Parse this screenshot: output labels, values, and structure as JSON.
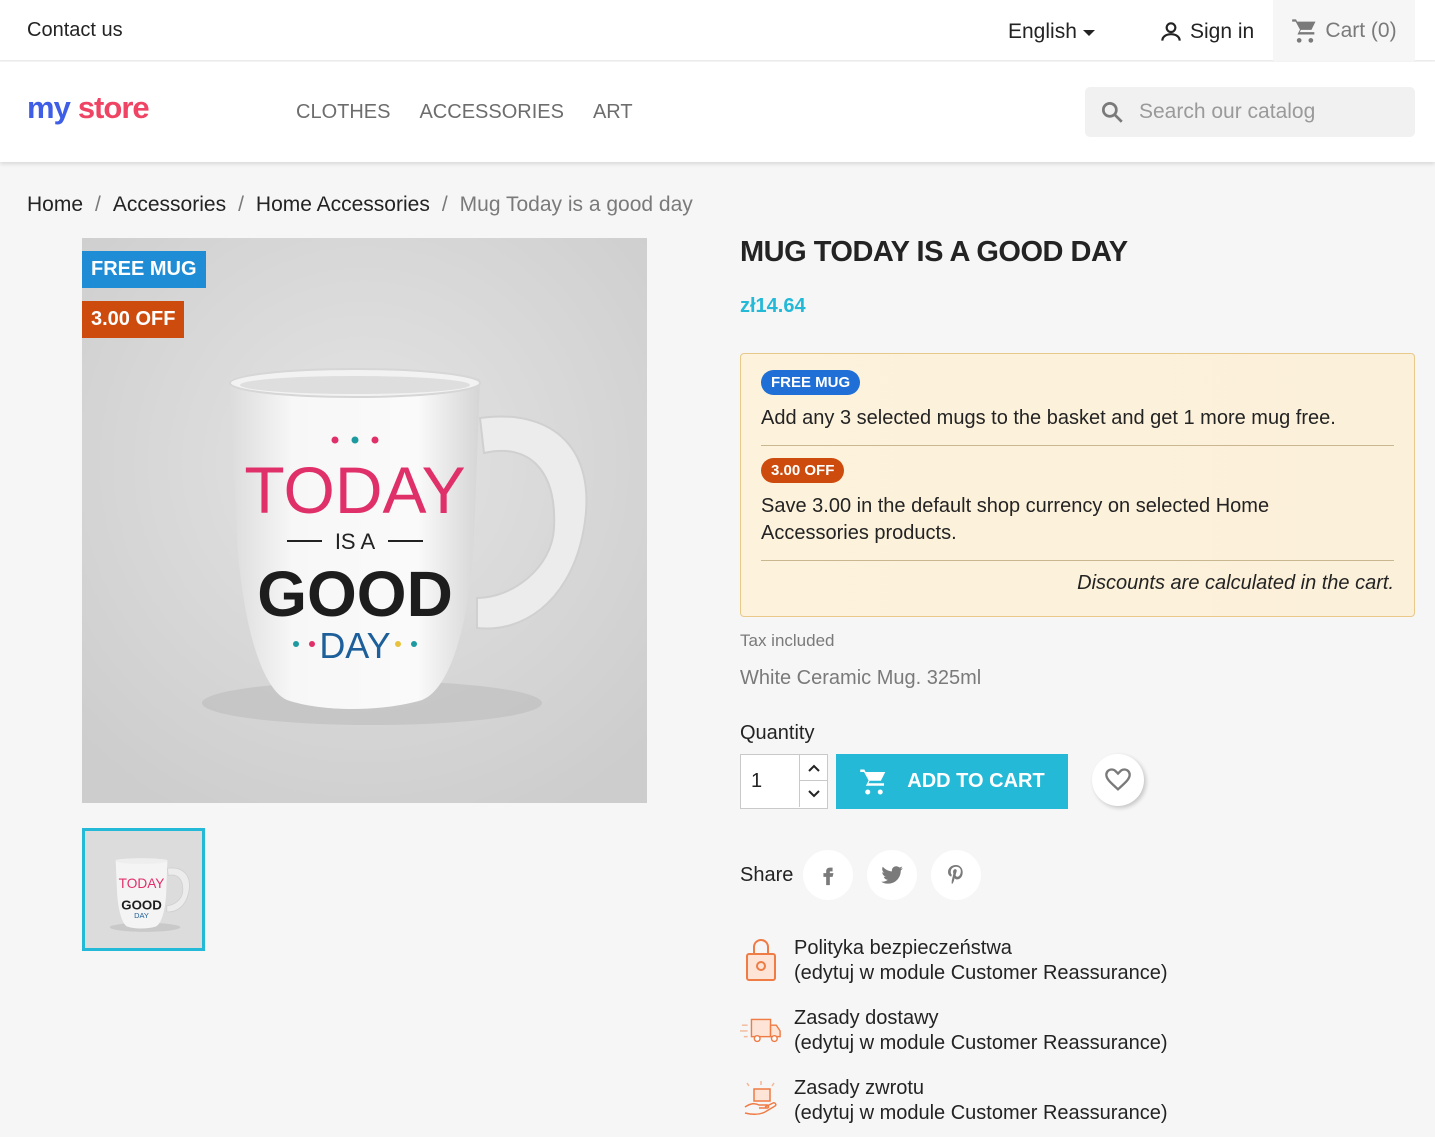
{
  "topbar": {
    "contact": "Contact us",
    "language": "English",
    "signin": "Sign in",
    "cart": "Cart (0)"
  },
  "header": {
    "logo_my": "my",
    "logo_store": "store",
    "menu": [
      "CLOTHES",
      "ACCESSORIES",
      "ART"
    ],
    "search_placeholder": "Search our catalog"
  },
  "breadcrumb": [
    "Home",
    "Accessories",
    "Home Accessories",
    "Mug Today is a good day"
  ],
  "product": {
    "flags": [
      "FREE MUG",
      "3.00 OFF"
    ],
    "title": "MUG TODAY IS A GOOD DAY",
    "price": "zł14.64",
    "mug_print": [
      "TODAY",
      "IS A",
      "GOOD",
      "DAY"
    ],
    "promos": [
      {
        "badge": "FREE MUG",
        "text": "Add any 3 selected mugs to the basket and get 1 more mug free."
      },
      {
        "badge": "3.00 OFF",
        "text": "Save 3.00 in the default shop currency on selected Home Accessories products."
      }
    ],
    "promo_note": "Discounts are calculated in the cart.",
    "tax": "Tax included",
    "description": "White Ceramic Mug. 325ml",
    "quantity_label": "Quantity",
    "quantity_value": "1",
    "add_to_cart": "ADD TO CART",
    "share_label": "Share"
  },
  "reassurance": [
    {
      "icon": "shopping-bag-lock-icon",
      "title": "Polityka bezpieczeństwa",
      "sub": "(edytuj w module Customer Reassurance)"
    },
    {
      "icon": "delivery-truck-icon",
      "title": "Zasady dostawy",
      "sub": "(edytuj w module Customer Reassurance)"
    },
    {
      "icon": "return-package-icon",
      "title": "Zasady zwrotu",
      "sub": "(edytuj w module Customer Reassurance)"
    }
  ],
  "colors": {
    "accent": "#24b9d7",
    "flag_blue": "#1f8dd6",
    "flag_orange": "#cd4b0c",
    "logo_blue": "#3e5ee6",
    "logo_red": "#ef4463"
  }
}
